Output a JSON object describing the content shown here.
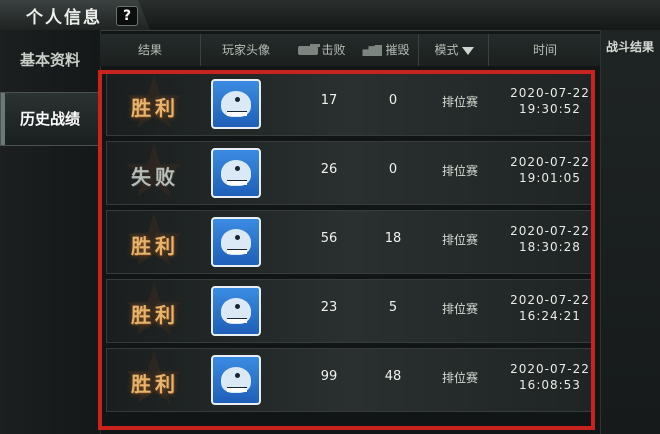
{
  "header": {
    "title": "个人信息",
    "help_label": "?"
  },
  "sidebar": {
    "items": [
      {
        "label": "基本资料"
      },
      {
        "label": "历史战绩"
      }
    ]
  },
  "columns": {
    "result": "结果",
    "avatar": "玩家头像",
    "kills": "击败",
    "destroy": "摧毁",
    "mode": "模式",
    "time": "时间"
  },
  "right_panel": {
    "title": "战斗结果"
  },
  "rows": [
    {
      "result": "胜利",
      "outcome": "win",
      "kills": "17",
      "destroy": "0",
      "mode": "排位赛",
      "date": "2020-07-22",
      "time": "19:30:52"
    },
    {
      "result": "失败",
      "outcome": "lose",
      "kills": "26",
      "destroy": "0",
      "mode": "排位赛",
      "date": "2020-07-22",
      "time": "19:01:05"
    },
    {
      "result": "胜利",
      "outcome": "win",
      "kills": "56",
      "destroy": "18",
      "mode": "排位赛",
      "date": "2020-07-22",
      "time": "18:30:28"
    },
    {
      "result": "胜利",
      "outcome": "win",
      "kills": "23",
      "destroy": "5",
      "mode": "排位赛",
      "date": "2020-07-22",
      "time": "16:24:21"
    },
    {
      "result": "胜利",
      "outcome": "win",
      "kills": "99",
      "destroy": "48",
      "mode": "排位赛",
      "date": "2020-07-22",
      "time": "16:08:53"
    }
  ],
  "colors": {
    "highlight": "#c8231e",
    "win": "#e6b46e",
    "lose": "#b7bcb7"
  }
}
